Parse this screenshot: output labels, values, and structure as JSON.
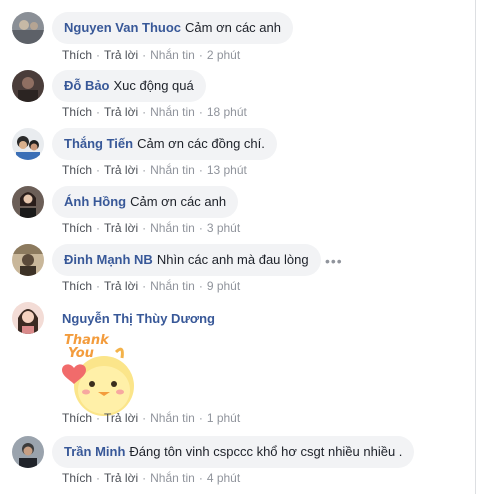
{
  "actions": {
    "like": "Thích",
    "reply": "Trả lời",
    "message": "Nhắn tin",
    "separator": "·"
  },
  "comments": [
    {
      "author": "Nguyen Van Thuoc",
      "text": "Cảm ơn các anh",
      "time": "2 phút"
    },
    {
      "author": "Đỗ Bảo",
      "text": "Xuc động quá",
      "time": "18 phút"
    },
    {
      "author": "Thắng Tiến",
      "text": "Cảm ơn các đồng chí.",
      "time": "13 phút"
    },
    {
      "author": "Ánh Hồng",
      "text": "Cảm ơn các anh",
      "time": "3 phút"
    },
    {
      "author": "Đinh Mạnh NB",
      "text": "Nhìn các anh mà đau lòng",
      "time": "9 phút",
      "more_icon": "more-horizontal-icon"
    },
    {
      "author": "Nguyễn Thị Thùy Dương",
      "text": "",
      "sticker": {
        "text_line1": "Thank",
        "text_line2": "You",
        "icon": "thank-you-chick-sticker"
      },
      "time": "1 phút"
    },
    {
      "author": "Trần Minh",
      "text": "Đáng tôn vinh cspccc khổ hơ csgt nhiều nhiều .",
      "time": "4 phút"
    }
  ],
  "colors": {
    "author": "#385898",
    "bubble": "#f2f3f5",
    "meta": "#90949c"
  }
}
